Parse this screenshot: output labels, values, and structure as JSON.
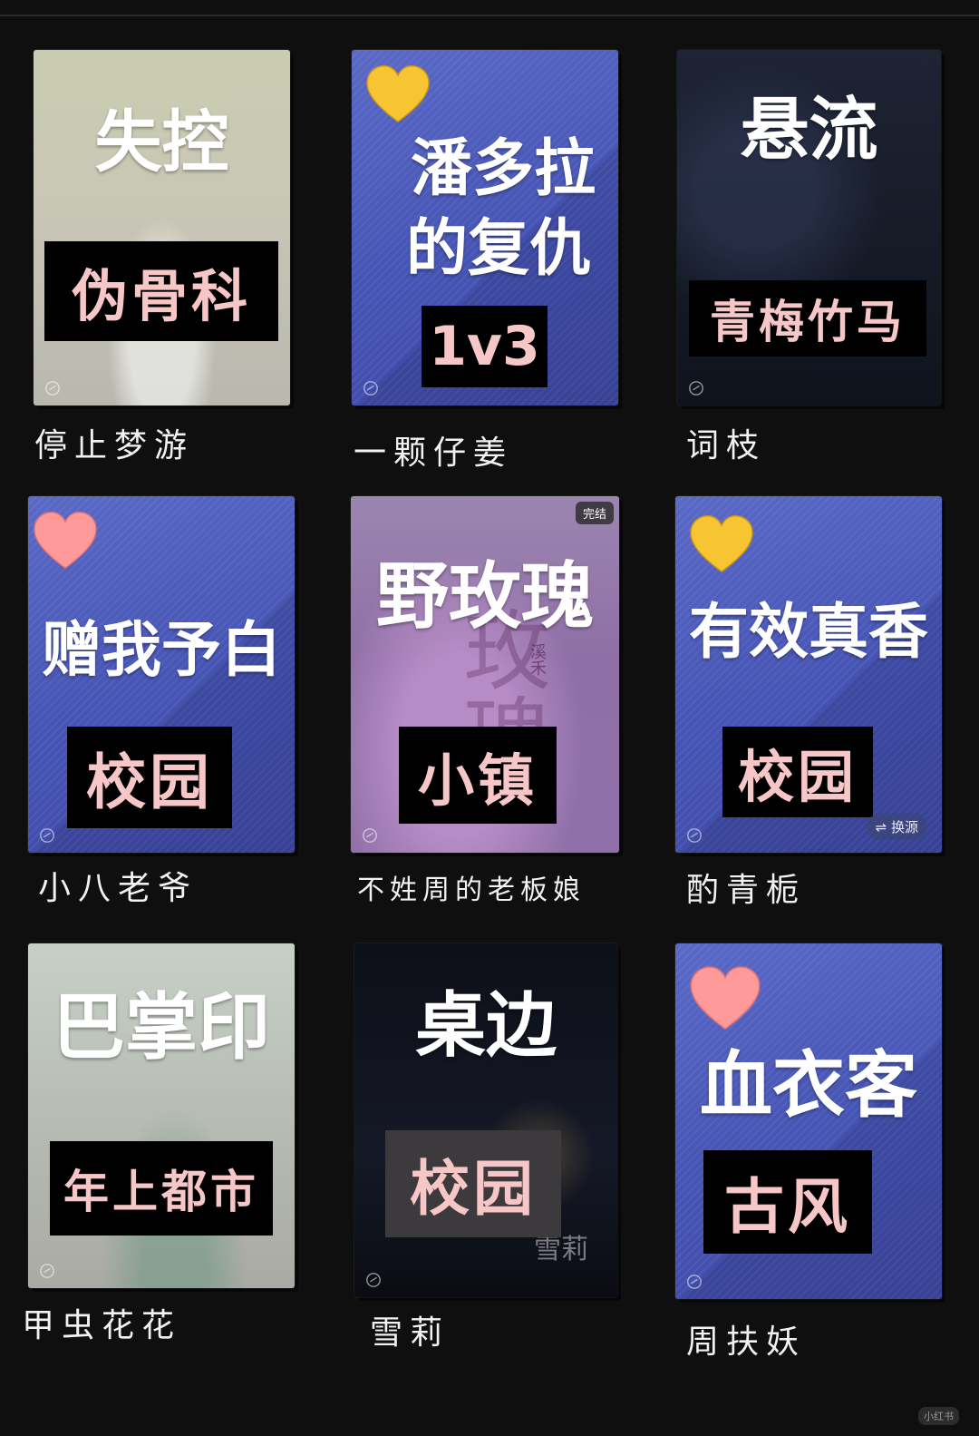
{
  "books": [
    {
      "title": "失控",
      "tag": "伪骨科",
      "author": "停止梦游",
      "badge": null,
      "switch": null
    },
    {
      "title": "潘多拉的复仇",
      "tag": "1v3",
      "author": "一颗仔姜",
      "badge": null,
      "switch": null
    },
    {
      "title": "悬流",
      "tag": "青梅竹马",
      "author": "词枝",
      "badge": null,
      "switch": null
    },
    {
      "title": "赠我予白",
      "tag": "校园",
      "author": "小八老爷",
      "badge": null,
      "switch": null
    },
    {
      "title": "野玫瑰",
      "tag": "小镇",
      "author": "不姓周的老板娘",
      "badge": "完结",
      "switch": null
    },
    {
      "title": "有效真香",
      "tag": "校园",
      "author": "酌青栀",
      "badge": null,
      "switch": "⇌ 换源"
    },
    {
      "title": "巴掌印",
      "tag": "年上都市",
      "author": "甲虫花花",
      "badge": null,
      "switch": null
    },
    {
      "title": "桌边",
      "tag": "校园",
      "author": "雪莉",
      "badge": null,
      "switch": null
    },
    {
      "title": "血衣客",
      "tag": "古风",
      "author": "周扶妖",
      "badge": null,
      "switch": null
    }
  ],
  "cover_texts": {
    "title_line1_b2": "潘多拉",
    "title_line2_b2": "的复仇",
    "deco_b5_author": "溪禾",
    "deco_b5_big": "玫瑰",
    "deco_b8": "雪莉"
  },
  "icons": {
    "heart_yellow": "yellow-heart-icon",
    "heart_pink": "pink-heart-icon",
    "link": "link-icon"
  },
  "colors": {
    "background": "#0f0f10",
    "tag_text": "#f6c7c6",
    "blue_cover": "#4553b4",
    "heart_yellow": "#f7c531",
    "heart_pink": "#ff9a9a"
  },
  "watermark": "小红书"
}
